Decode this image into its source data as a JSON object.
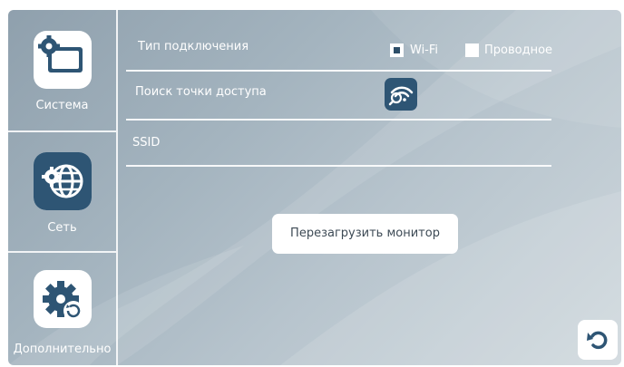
{
  "sidebar": {
    "items": [
      {
        "label": "Система",
        "icon": "settings-screen-icon",
        "selected": false
      },
      {
        "label": "Сеть",
        "icon": "network-globe-icon",
        "selected": true
      },
      {
        "label": "Дополнительно",
        "icon": "gear-refresh-icon",
        "selected": false
      }
    ]
  },
  "connection": {
    "label": "Тип подключения",
    "options": [
      {
        "label": "Wi-Fi",
        "checked": true
      },
      {
        "label": "Проводное",
        "checked": false
      }
    ]
  },
  "access_point": {
    "label": "Поиск точки доступа",
    "icon": "wifi-search-icon"
  },
  "ssid": {
    "label": "SSID",
    "value": ""
  },
  "reboot_button": {
    "label": "Перезагрузить монитор"
  },
  "back_button": {
    "icon": "back-arrow-icon"
  },
  "colors": {
    "accent": "#2e5574",
    "background": "#a4b4bf"
  }
}
